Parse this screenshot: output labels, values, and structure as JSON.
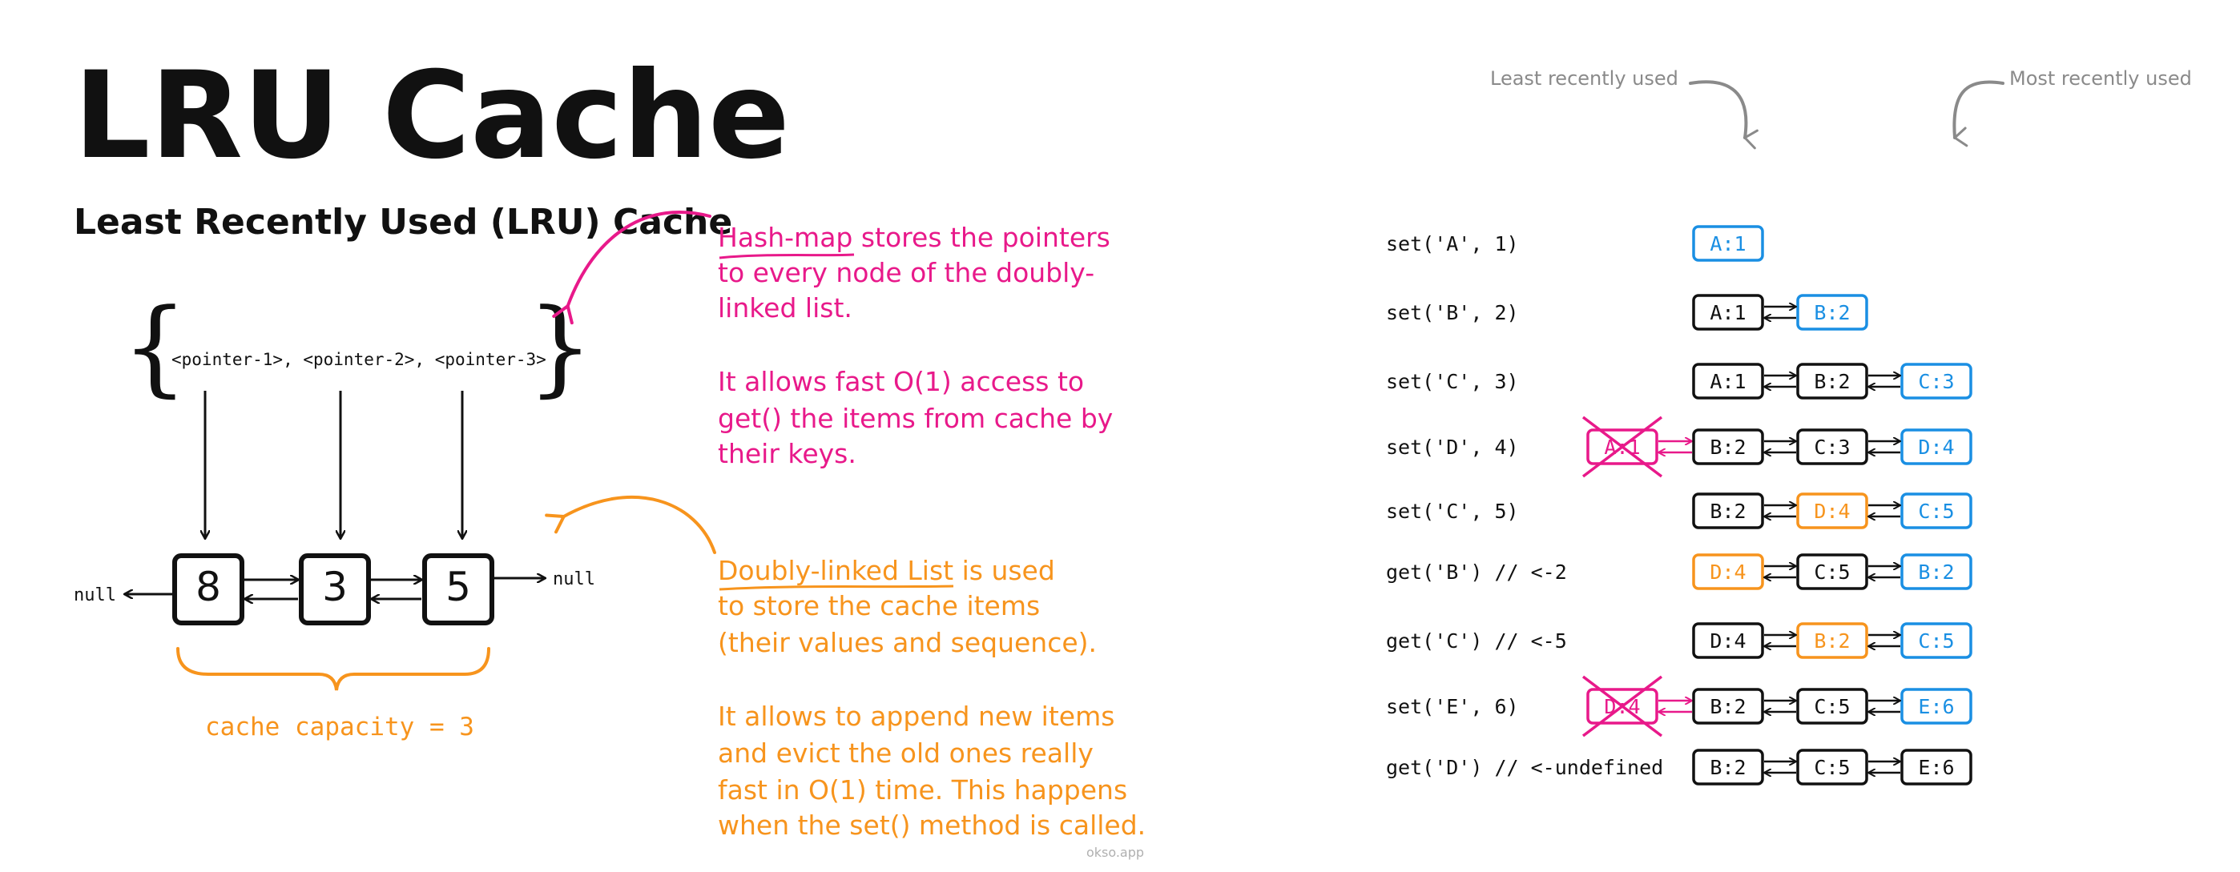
{
  "title": "LRU Cache",
  "subtitle": "Least Recently Used (LRU) Cache",
  "colors": {
    "black": "#111111",
    "pink": "#e8198a",
    "orange": "#f7941d",
    "blue": "#1a8fe3",
    "gray": "#8a8a8a"
  },
  "hashmap": {
    "open_brace": "{",
    "close_brace": "}",
    "pointers_text": "<pointer-1>, <pointer-2>, <pointer-3>"
  },
  "list": {
    "null_left": "null",
    "null_right": "null",
    "nodes": [
      "8",
      "3",
      "5"
    ],
    "capacity_label": "cache capacity = 3"
  },
  "notes": {
    "hashmap_title": "Hash-map",
    "hashmap_lines": [
      "Hash-map stores the pointers",
      "to every node of the doubly-",
      "linked list.",
      "",
      "It allows fast O(1) access to",
      "get() the items from cache by",
      "their keys."
    ],
    "list_title": "Doubly-linked List",
    "list_lines": [
      "Doubly-linked List is used",
      "to store the cache items",
      "(their values and sequence).",
      "",
      "It allows to append new items",
      "and evict the old ones really",
      "fast in O(1) time. This happens",
      "when the set() method is called."
    ]
  },
  "legend": {
    "least": "Least recently used",
    "most": "Most recently used"
  },
  "watermark": "okso.app",
  "operations": [
    {
      "op": "set('A', 1)",
      "nodes": [
        {
          "label": "A:1",
          "color": "blue"
        }
      ],
      "evicted": null
    },
    {
      "op": "set('B', 2)",
      "nodes": [
        {
          "label": "A:1",
          "color": "black"
        },
        {
          "label": "B:2",
          "color": "blue"
        }
      ],
      "evicted": null
    },
    {
      "op": "set('C', 3)",
      "nodes": [
        {
          "label": "A:1",
          "color": "black"
        },
        {
          "label": "B:2",
          "color": "black"
        },
        {
          "label": "C:3",
          "color": "blue"
        }
      ],
      "evicted": null
    },
    {
      "op": "set('D', 4)",
      "nodes": [
        {
          "label": "B:2",
          "color": "black"
        },
        {
          "label": "C:3",
          "color": "black"
        },
        {
          "label": "D:4",
          "color": "blue"
        }
      ],
      "evicted": "A:1"
    },
    {
      "op": "set('C', 5)",
      "nodes": [
        {
          "label": "B:2",
          "color": "black"
        },
        {
          "label": "D:4",
          "color": "orange"
        },
        {
          "label": "C:5",
          "color": "blue"
        }
      ],
      "evicted": null
    },
    {
      "op": "get('B') // <-2",
      "nodes": [
        {
          "label": "D:4",
          "color": "orange"
        },
        {
          "label": "C:5",
          "color": "black"
        },
        {
          "label": "B:2",
          "color": "blue"
        }
      ],
      "evicted": null
    },
    {
      "op": "get('C') // <-5",
      "nodes": [
        {
          "label": "D:4",
          "color": "black"
        },
        {
          "label": "B:2",
          "color": "orange"
        },
        {
          "label": "C:5",
          "color": "blue"
        }
      ],
      "evicted": null
    },
    {
      "op": "set('E', 6)",
      "nodes": [
        {
          "label": "B:2",
          "color": "black"
        },
        {
          "label": "C:5",
          "color": "black"
        },
        {
          "label": "E:6",
          "color": "blue"
        }
      ],
      "evicted": "D:4"
    },
    {
      "op": "get('D') // <-undefined",
      "nodes": [
        {
          "label": "B:2",
          "color": "black"
        },
        {
          "label": "C:5",
          "color": "black"
        },
        {
          "label": "E:6",
          "color": "black"
        }
      ],
      "evicted": null
    }
  ]
}
